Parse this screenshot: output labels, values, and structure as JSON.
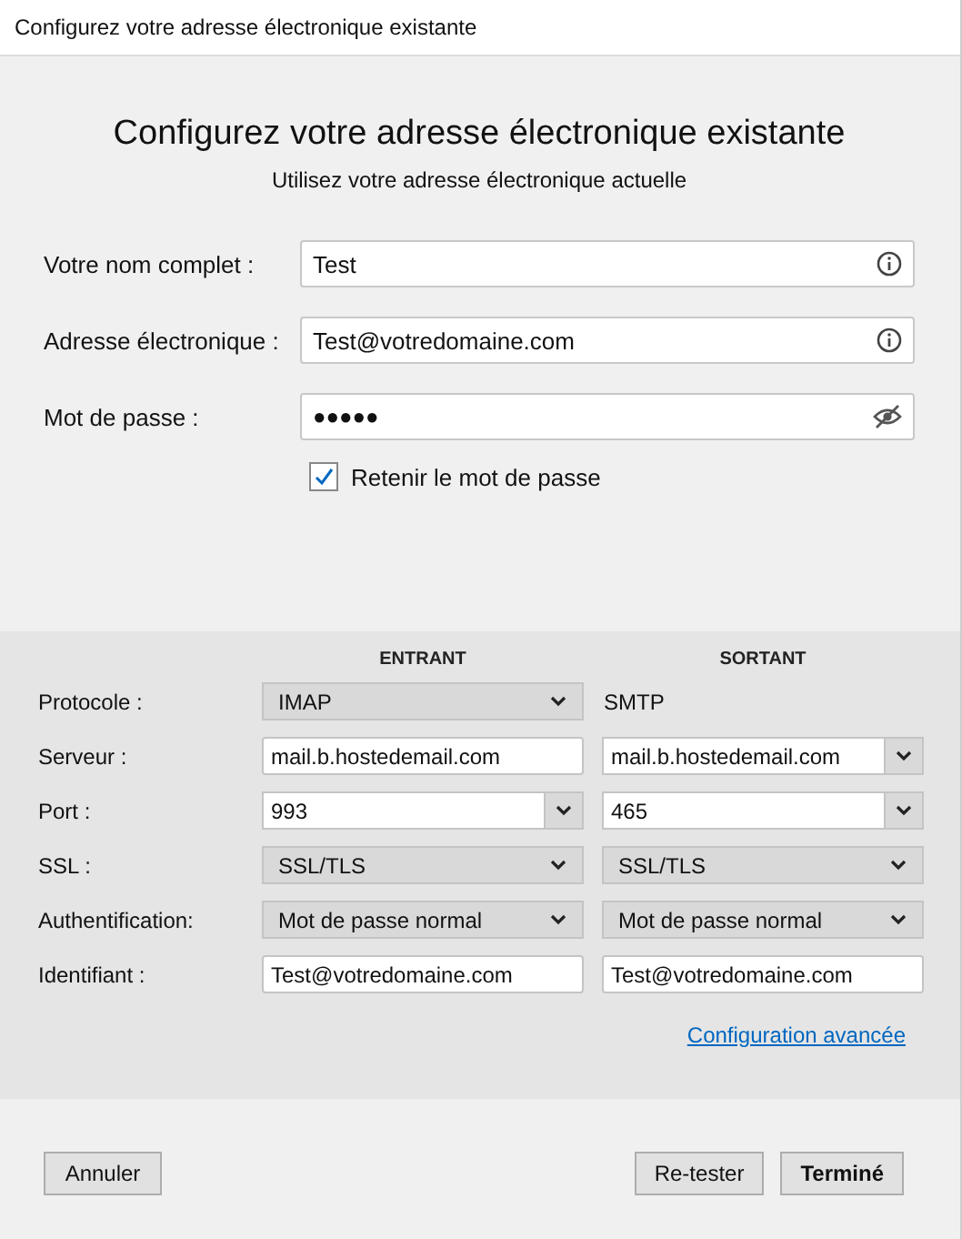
{
  "window": {
    "title": "Configurez votre adresse électronique existante"
  },
  "heading": "Configurez votre adresse électronique existante",
  "subheading": "Utilisez votre adresse électronique actuelle",
  "fields": [
    {
      "label": "Votre nom complet :",
      "value": "Test",
      "kind": "info"
    },
    {
      "label": "Adresse électronique :",
      "value": "Test@votredomaine.com",
      "kind": "info"
    },
    {
      "label": "Mot de passe :",
      "value": "●●●●●",
      "kind": "password"
    }
  ],
  "remember": {
    "label": "Retenir le mot de passe",
    "checked": true
  },
  "server": {
    "columns": [
      "ENTRANT",
      "SORTANT"
    ],
    "rows": [
      {
        "label": "Protocole :",
        "cells": [
          {
            "kind": "select",
            "value": "IMAP"
          },
          {
            "kind": "plain",
            "value": "SMTP"
          }
        ]
      },
      {
        "label": "Serveur :",
        "cells": [
          {
            "kind": "text",
            "value": "mail.b.hostedemail.com"
          },
          {
            "kind": "combo",
            "value": "mail.b.hostedemail.com"
          }
        ]
      },
      {
        "label": "Port :",
        "cells": [
          {
            "kind": "combo",
            "value": "993"
          },
          {
            "kind": "combo",
            "value": "465"
          }
        ]
      },
      {
        "label": "SSL :",
        "cells": [
          {
            "kind": "select",
            "value": "SSL/TLS"
          },
          {
            "kind": "select",
            "value": "SSL/TLS"
          }
        ]
      },
      {
        "label": "Authentification:",
        "cells": [
          {
            "kind": "select",
            "value": "Mot de passe normal"
          },
          {
            "kind": "select",
            "value": "Mot de passe normal"
          }
        ]
      },
      {
        "label": "Identifiant :",
        "cells": [
          {
            "kind": "text",
            "value": "Test@votredomaine.com"
          },
          {
            "kind": "text",
            "value": "Test@votredomaine.com"
          }
        ]
      }
    ],
    "advanced_link": "Configuration avancée"
  },
  "buttons_left": [
    {
      "label": "Annuler",
      "default": false
    }
  ],
  "buttons_right": [
    {
      "label": "Re-tester",
      "default": false
    },
    {
      "label": "Terminé",
      "default": true
    }
  ]
}
